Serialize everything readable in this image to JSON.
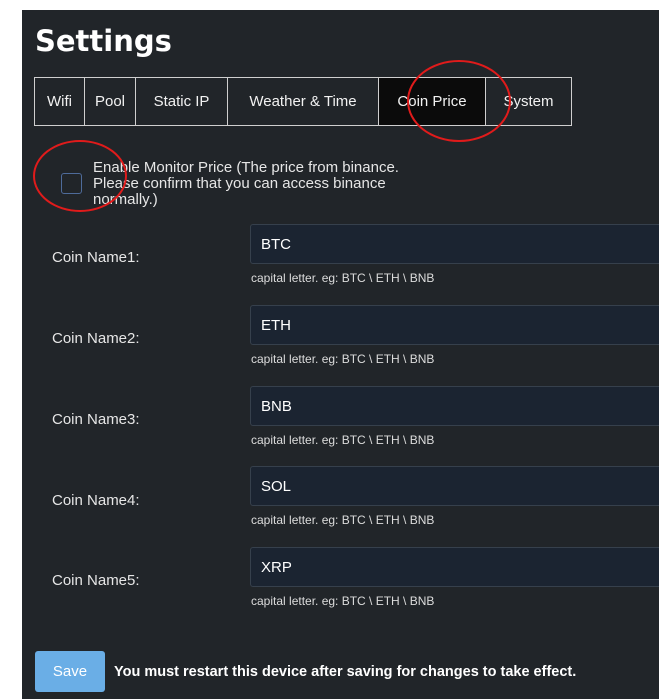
{
  "page": {
    "title": "Settings"
  },
  "tabs": [
    {
      "label": "Wifi"
    },
    {
      "label": "Pool"
    },
    {
      "label": "Static IP"
    },
    {
      "label": "Weather & Time"
    },
    {
      "label": "Coin Price",
      "active": true
    },
    {
      "label": "System"
    }
  ],
  "monitor": {
    "checked": false,
    "label": "Enable Monitor Price (The price from binance. Please confirm that you can access binance normally.)"
  },
  "coins": [
    {
      "label": "Coin Name1:",
      "value": "BTC",
      "hint": "capital letter. eg: BTC \\ ETH \\ BNB"
    },
    {
      "label": "Coin Name2:",
      "value": "ETH",
      "hint": "capital letter. eg: BTC \\ ETH \\ BNB"
    },
    {
      "label": "Coin Name3:",
      "value": "BNB",
      "hint": "capital letter. eg: BTC \\ ETH \\ BNB"
    },
    {
      "label": "Coin Name4:",
      "value": "SOL",
      "hint": "capital letter. eg: BTC \\ ETH \\ BNB"
    },
    {
      "label": "Coin Name5:",
      "value": "XRP",
      "hint": "capital letter. eg: BTC \\ ETH \\ BNB"
    }
  ],
  "footer": {
    "save_label": "Save",
    "note": "You must restart this device after saving for changes to take effect."
  },
  "colors": {
    "panel_bg": "#212529",
    "annotation_red": "#e01b1b",
    "save_button": "#6aaee6",
    "input_bg": "#1b2431"
  }
}
